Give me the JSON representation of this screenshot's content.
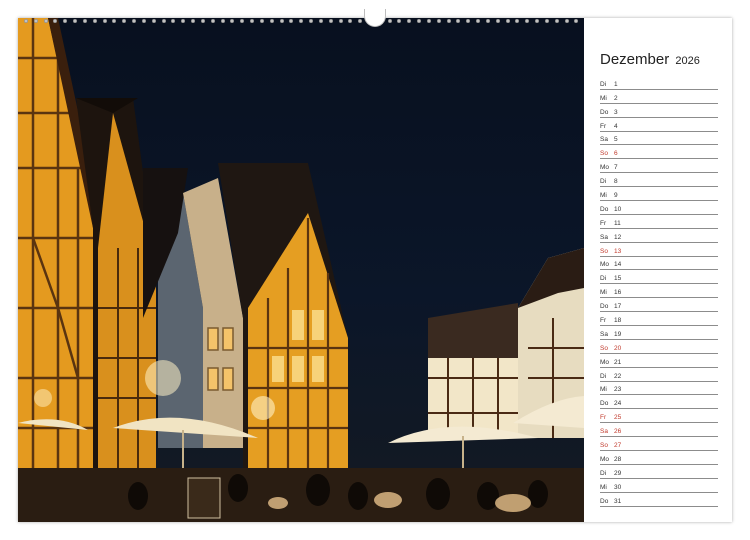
{
  "calendar": {
    "month": "Dezember",
    "year": "2026",
    "days": [
      {
        "wd": "Di",
        "d": "1"
      },
      {
        "wd": "Mi",
        "d": "2"
      },
      {
        "wd": "Do",
        "d": "3"
      },
      {
        "wd": "Fr",
        "d": "4"
      },
      {
        "wd": "Sa",
        "d": "5"
      },
      {
        "wd": "So",
        "d": "6",
        "red": true
      },
      {
        "wd": "Mo",
        "d": "7"
      },
      {
        "wd": "Di",
        "d": "8"
      },
      {
        "wd": "Mi",
        "d": "9"
      },
      {
        "wd": "Do",
        "d": "10"
      },
      {
        "wd": "Fr",
        "d": "11"
      },
      {
        "wd": "Sa",
        "d": "12"
      },
      {
        "wd": "So",
        "d": "13",
        "red": true
      },
      {
        "wd": "Mo",
        "d": "14"
      },
      {
        "wd": "Di",
        "d": "15"
      },
      {
        "wd": "Mi",
        "d": "16"
      },
      {
        "wd": "Do",
        "d": "17"
      },
      {
        "wd": "Fr",
        "d": "18"
      },
      {
        "wd": "Sa",
        "d": "19"
      },
      {
        "wd": "So",
        "d": "20",
        "red": true
      },
      {
        "wd": "Mo",
        "d": "21"
      },
      {
        "wd": "Di",
        "d": "22"
      },
      {
        "wd": "Mi",
        "d": "23"
      },
      {
        "wd": "Do",
        "d": "24"
      },
      {
        "wd": "Fr",
        "d": "25",
        "red": true
      },
      {
        "wd": "Sa",
        "d": "26",
        "red": true
      },
      {
        "wd": "So",
        "d": "27",
        "red": true
      },
      {
        "wd": "Mo",
        "d": "28"
      },
      {
        "wd": "Di",
        "d": "29"
      },
      {
        "wd": "Mi",
        "d": "30"
      },
      {
        "wd": "Do",
        "d": "31"
      }
    ]
  },
  "colors": {
    "holiday": "#c0392b",
    "line": "#8c8c8c",
    "sky": "#0b1629",
    "timber_glow": "#f3a21c"
  },
  "icons": {
    "hanger": "calendar-hanger-icon",
    "binding": "spiral-binding-icon"
  }
}
